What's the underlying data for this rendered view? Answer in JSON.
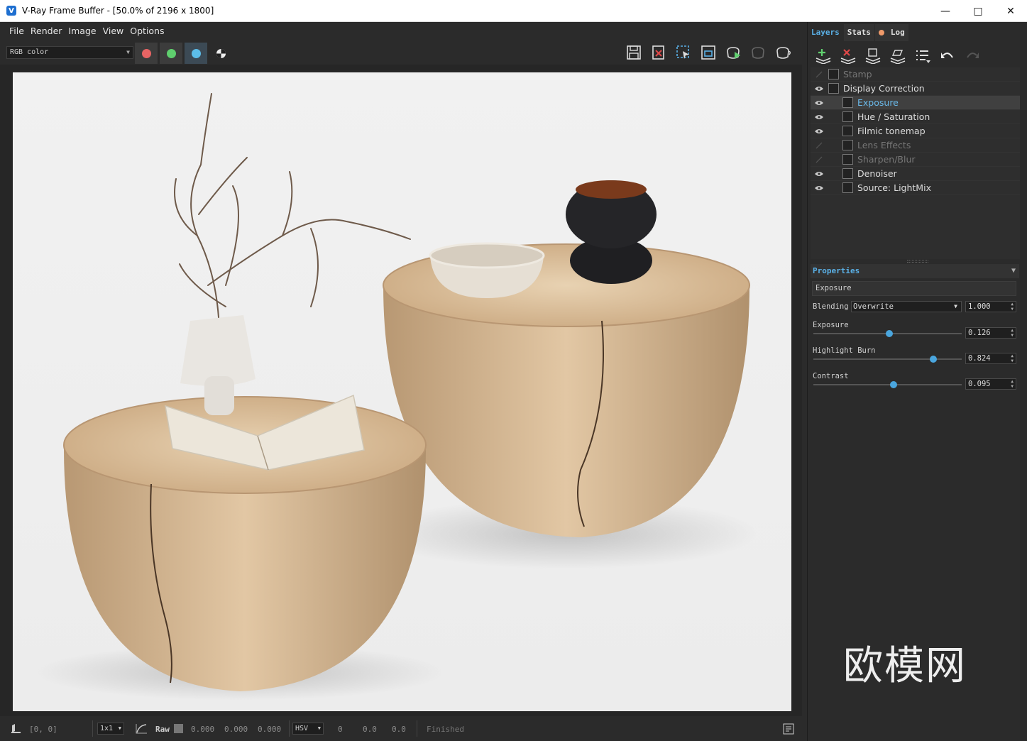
{
  "window": {
    "title": "V-Ray Frame Buffer - [50.0% of 2196 x 1800]",
    "controls": [
      "minimize-icon",
      "maximize-icon",
      "close-icon"
    ]
  },
  "menu": [
    "File",
    "Render",
    "Image",
    "View",
    "Options"
  ],
  "toolbar": {
    "channel": "RGB color",
    "channel_buttons": [
      {
        "name": "red-channel-button",
        "color": "#e86464",
        "pressed": true
      },
      {
        "name": "green-channel-button",
        "color": "#5fcf6e",
        "pressed": true
      },
      {
        "name": "blue-channel-button",
        "color": "#5cbde8",
        "pressed": true
      },
      {
        "name": "mono-channel-button",
        "color": "#ffffff",
        "pressed": false
      }
    ],
    "icons": [
      "save-image-icon",
      "clear-image-icon",
      "region-render-icon",
      "follow-mouse-icon",
      "render-interactive-icon",
      "stop-render-icon",
      "render-icon"
    ]
  },
  "statusbar": {
    "coords": "[0, 0]",
    "zoom": "1x1",
    "raw": "Raw",
    "rgb": [
      "0.000",
      "0.000",
      "0.000"
    ],
    "color_mode": "HSV",
    "hsv": [
      "0",
      "0.0",
      "0.0"
    ],
    "status": "Finished"
  },
  "panel": {
    "tabs": [
      "Layers",
      "Stats",
      "Log"
    ],
    "active_tab": "Layers",
    "layers_toolbar": [
      "add-layer-icon",
      "delete-layer-icon",
      "save-layers-icon",
      "load-layers-icon",
      "layer-menu-icon",
      "undo-icon",
      "redo-icon"
    ],
    "layers": [
      {
        "name": "Stamp",
        "visible": false,
        "indent": 0,
        "selected": false
      },
      {
        "name": "Display Correction",
        "visible": true,
        "indent": 0,
        "selected": false
      },
      {
        "name": "Exposure",
        "visible": true,
        "indent": 1,
        "selected": true
      },
      {
        "name": "Hue / Saturation",
        "visible": true,
        "indent": 1,
        "selected": false
      },
      {
        "name": "Filmic tonemap",
        "visible": true,
        "indent": 1,
        "selected": false
      },
      {
        "name": "Lens Effects",
        "visible": false,
        "indent": 1,
        "selected": false
      },
      {
        "name": "Sharpen/Blur",
        "visible": false,
        "indent": 1,
        "selected": false
      },
      {
        "name": "Denoiser",
        "visible": true,
        "indent": 1,
        "selected": false
      },
      {
        "name": "Source: LightMix",
        "visible": true,
        "indent": 1,
        "selected": false
      }
    ],
    "properties": {
      "header": "Properties",
      "layer_name": "Exposure",
      "blending_label": "Blending",
      "blending_mode": "Overwrite",
      "blending_value": "1.000",
      "sliders": [
        {
          "label": "Exposure",
          "value": "0.126",
          "knob": 0.51
        },
        {
          "label": "Highlight Burn",
          "value": "0.824",
          "knob": 0.81
        },
        {
          "label": "Contrast",
          "value": "0.095",
          "knob": 0.54
        }
      ]
    }
  },
  "watermark": "欧模网",
  "colors": {
    "accent": "#5ab0e6",
    "panel_bg": "#2b2b2b",
    "render_bg": "#f0f0f0"
  }
}
